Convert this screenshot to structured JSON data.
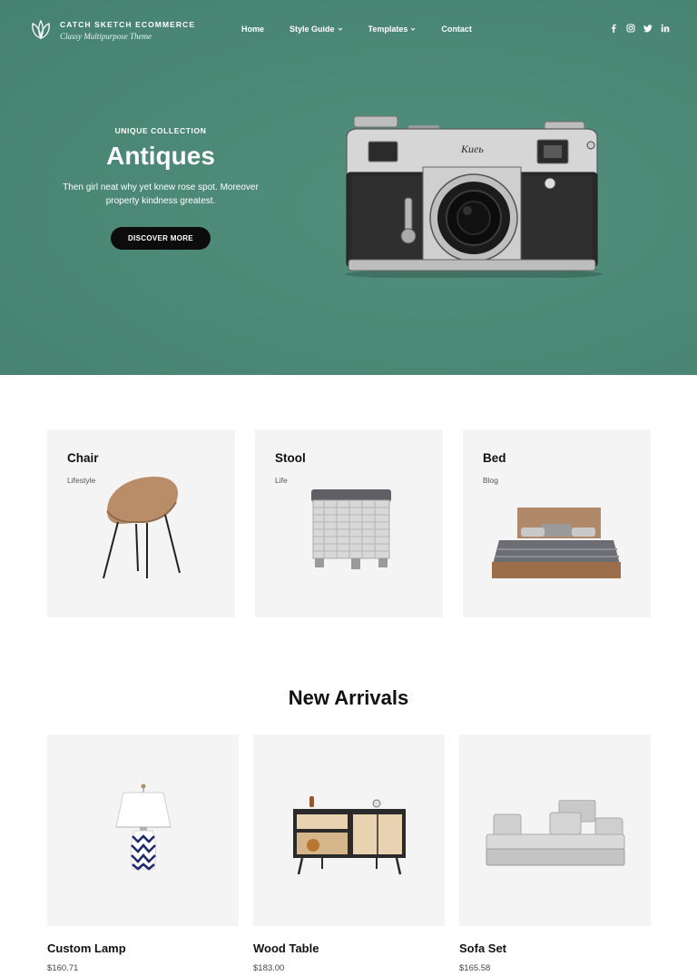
{
  "brand": {
    "site_title": "CATCH SKETCH ECOMMERCE",
    "tagline": "Classy Multipurpose Theme",
    "colors": {
      "hero_bg": "#4a8a76",
      "button_bg": "#0c0c0c",
      "card_bg": "#f4f4f4"
    }
  },
  "nav": {
    "items": [
      {
        "label": "Home",
        "has_dropdown": false
      },
      {
        "label": "Style Guide",
        "has_dropdown": true
      },
      {
        "label": "Templates",
        "has_dropdown": true
      },
      {
        "label": "Contact",
        "has_dropdown": false
      }
    ]
  },
  "social": [
    "facebook-icon",
    "instagram-icon",
    "twitter-icon",
    "linkedin-icon"
  ],
  "hero": {
    "eyebrow": "UNIQUE COLLECTION",
    "title": "Antiques",
    "description": "Then girl neat why yet knew rose spot. Moreover property kindness greatest.",
    "cta_label": "DISCOVER MORE",
    "image": "vintage-camera"
  },
  "categories": [
    {
      "title": "Chair",
      "subtitle": "Lifestyle",
      "image": "chair"
    },
    {
      "title": "Stool",
      "subtitle": "Life",
      "image": "wicker-stool"
    },
    {
      "title": "Bed",
      "subtitle": "Blog",
      "image": "bed"
    }
  ],
  "new_arrivals": {
    "title": "New Arrivals",
    "products": [
      {
        "name": "Custom Lamp",
        "price": "$160.71",
        "image": "table-lamp"
      },
      {
        "name": "Wood Table",
        "price": "$183.00",
        "image": "sideboard"
      },
      {
        "name": "Sofa Set",
        "price": "$165.58",
        "image": "sofa"
      }
    ]
  }
}
